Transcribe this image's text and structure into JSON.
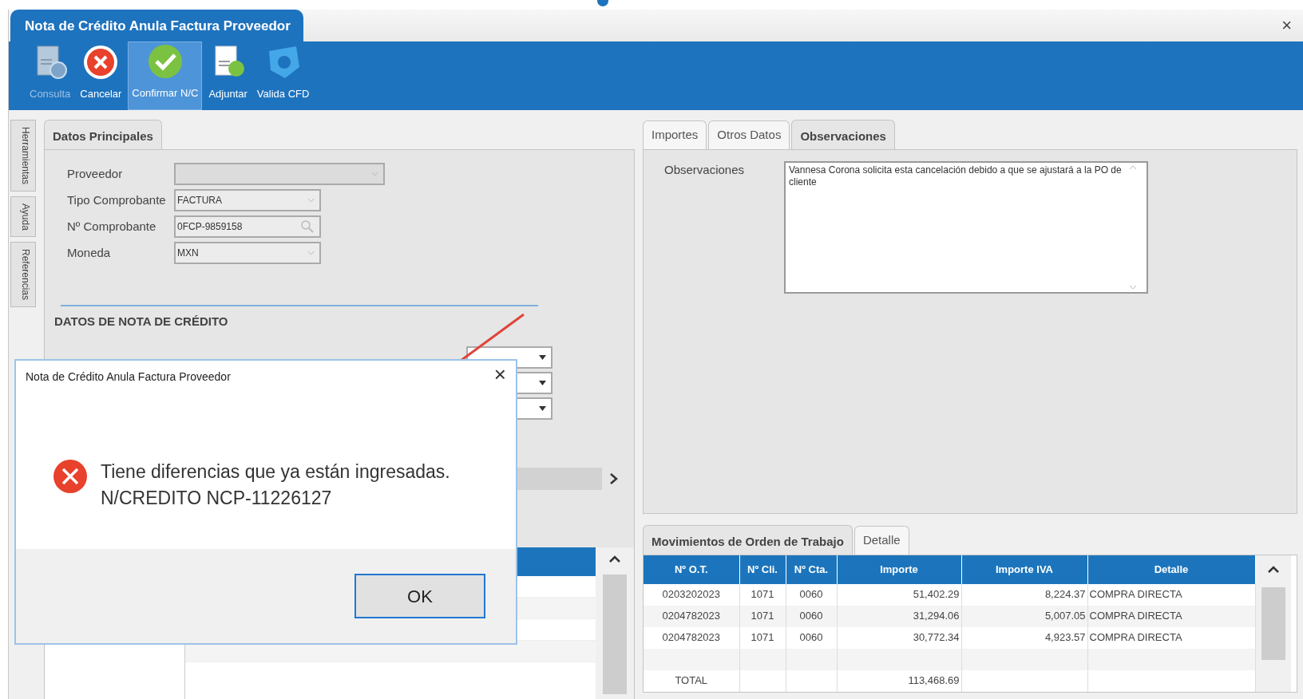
{
  "window": {
    "title": "Nota de Crédito Anula Factura Proveedor",
    "close": "×"
  },
  "toolbar": [
    {
      "label": "Consulta",
      "kind": "consulta",
      "selected": false,
      "disabled": true
    },
    {
      "label": "Cancelar",
      "kind": "cancelar",
      "selected": false,
      "disabled": false
    },
    {
      "label": "Confirmar N/C",
      "kind": "confirmar",
      "selected": true,
      "disabled": false
    },
    {
      "label": "Adjuntar",
      "kind": "adjuntar",
      "selected": false,
      "disabled": false
    },
    {
      "label": "Valida CFD",
      "kind": "valida",
      "selected": false,
      "disabled": false
    }
  ],
  "side_tabs": [
    "Herramientas",
    "Ayuda",
    "Referencias"
  ],
  "left_tabs": [
    {
      "label": "Datos Principales",
      "selected": true
    }
  ],
  "fields": [
    {
      "label": "Proveedor",
      "kind": "dropdown"
    },
    {
      "label": "Tipo Comprobante",
      "value": "FACTURA",
      "kind": "dropdown"
    },
    {
      "label": "Nº Comprobante",
      "value": "0FCP-9859158",
      "kind": "search"
    },
    {
      "label": "Moneda",
      "value": "MXN",
      "kind": "dropdown"
    }
  ],
  "section_title": "DATOS DE NOTA DE CRÉDITO",
  "right_tabs": [
    {
      "label": "Importes",
      "selected": false
    },
    {
      "label": "Otros Datos",
      "selected": false
    },
    {
      "label": "Observaciones",
      "selected": true
    }
  ],
  "observaciones": {
    "label": "Observaciones",
    "value": "Vannesa Corona solicita esta cancelación debido a que se ajustará a la PO de cliente"
  },
  "bottom_tabs": [
    {
      "label": "Movimientos de Orden de Trabajo",
      "selected": true
    },
    {
      "label": "Detalle",
      "selected": false
    }
  ],
  "grid": {
    "columns": [
      "Nº O.T.",
      "Nº Cli.",
      "Nº Cta.",
      "Importe",
      "Importe IVA",
      "Detalle"
    ],
    "rows": [
      [
        "0203202023",
        "1071",
        "0060",
        "51,402.29",
        "8,224.37",
        "COMPRA DIRECTA"
      ],
      [
        "0204782023",
        "1071",
        "0060",
        "31,294.06",
        "5,007.05",
        "COMPRA DIRECTA"
      ],
      [
        "0204782023",
        "1071",
        "0060",
        "30,772.34",
        "4,923.57",
        "COMPRA DIRECTA"
      ]
    ],
    "total": {
      "label": "TOTAL",
      "importe": "113,468.69"
    }
  },
  "dialog": {
    "title": "Nota de Crédito Anula Factura Proveedor",
    "close": "×",
    "message": [
      "Tiene diferencias que ya están ingresadas.",
      "N/CREDITO NCP-11226127"
    ],
    "button": "OK"
  }
}
